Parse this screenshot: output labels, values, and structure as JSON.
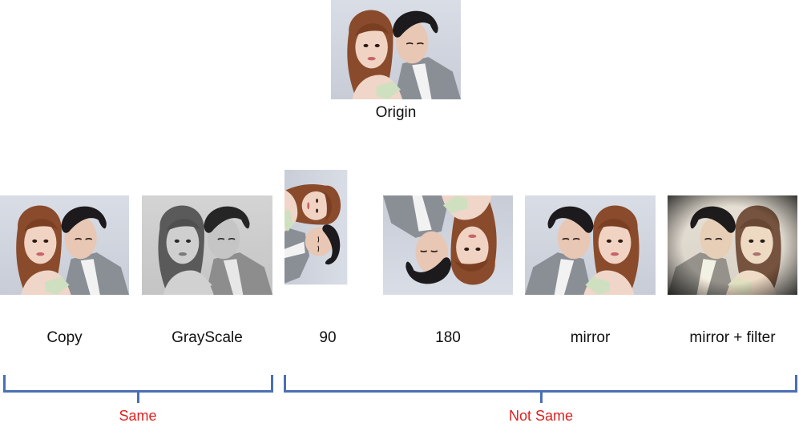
{
  "origin": {
    "label": "Origin"
  },
  "variants": [
    {
      "label": "Copy"
    },
    {
      "label": "GrayScale"
    },
    {
      "label": "90"
    },
    {
      "label": "180"
    },
    {
      "label": "mirror"
    },
    {
      "label": "mirror + filter"
    }
  ],
  "groups": [
    {
      "label": "Same"
    },
    {
      "label": "Not Same"
    }
  ],
  "colors": {
    "bracket": "#4a6fb3",
    "group_label": "#e02020"
  }
}
